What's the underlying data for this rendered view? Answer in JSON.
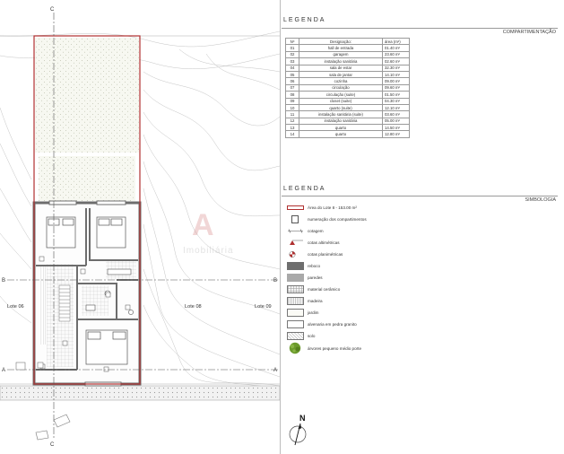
{
  "plan": {
    "section_marks": {
      "c_top": "C",
      "c_bottom": "C",
      "b_left": "B",
      "b_right": "B",
      "a_left": "A",
      "a_right": "A"
    },
    "lot_labels": {
      "left": "Lote 06",
      "center": "Lote 08",
      "right": "Lote 09"
    },
    "watermark": "Imobiliária"
  },
  "legend": {
    "title_top": "LEGENDA",
    "subtitle_top": "COMPARTIMENTAÇÃO",
    "table": {
      "headers": {
        "num": "Nº",
        "designation": "Designação:",
        "area": "área (m²)"
      },
      "rows": [
        {
          "num": "01",
          "designation": "hall de entrada",
          "area": "01.40  m²"
        },
        {
          "num": "02",
          "designation": "garagem",
          "area": "23.60  m²"
        },
        {
          "num": "03",
          "designation": "instalação sanitária",
          "area": "02.60  m²"
        },
        {
          "num": "04",
          "designation": "sala de estar",
          "area": "32.30  m²"
        },
        {
          "num": "05",
          "designation": "sala de jantar",
          "area": "14.10  m²"
        },
        {
          "num": "06",
          "designation": "cozinha",
          "area": "09.00  m²"
        },
        {
          "num": "07",
          "designation": "circulação",
          "area": "09.60  m²"
        },
        {
          "num": "08",
          "designation": "circulação (suite)",
          "area": "01.50  m²"
        },
        {
          "num": "09",
          "designation": "closet (suite)",
          "area": "04.30  m²"
        },
        {
          "num": "10",
          "designation": "quarto (suite)",
          "area": "12.10  m²"
        },
        {
          "num": "11",
          "designation": "instalação sanitária (suite)",
          "area": "03.60  m²"
        },
        {
          "num": "12",
          "designation": "instalação sanitária",
          "area": "05.00  m²"
        },
        {
          "num": "13",
          "designation": "quarto",
          "area": "14.50  m²"
        },
        {
          "num": "14",
          "designation": "quarto",
          "area": "12.80  m²"
        }
      ]
    },
    "title_bottom": "LEGENDA",
    "subtitle_bottom": "SIMBOLOGIA",
    "symbols": [
      {
        "key": "lot",
        "label": "Área do Lote 8 - 153.00 m²"
      },
      {
        "key": "num",
        "label": "numeração dos compartimentos"
      },
      {
        "key": "cotagem",
        "label": "cotagem"
      },
      {
        "key": "altimetricas",
        "label": "cotas altimétricas"
      },
      {
        "key": "planimetricas",
        "label": "cotas planimétricas"
      },
      {
        "key": "reboco",
        "label": "reboco"
      },
      {
        "key": "paredes",
        "label": "paredes"
      },
      {
        "key": "ceramic",
        "label": "material cerâmico"
      },
      {
        "key": "madeira",
        "label": "madeira"
      },
      {
        "key": "jardim",
        "label": "jardim"
      },
      {
        "key": "alvenaria",
        "label": "alvenaria em pedra granito"
      },
      {
        "key": "solo",
        "label": "solo"
      },
      {
        "key": "arvore",
        "label": "árvores pequeno médio porte"
      }
    ],
    "north_label": "N"
  },
  "colors": {
    "lot_outline": "#b03030",
    "wall": "#707070",
    "contour": "#c4c4c4",
    "tree": "#6b9a2c"
  }
}
